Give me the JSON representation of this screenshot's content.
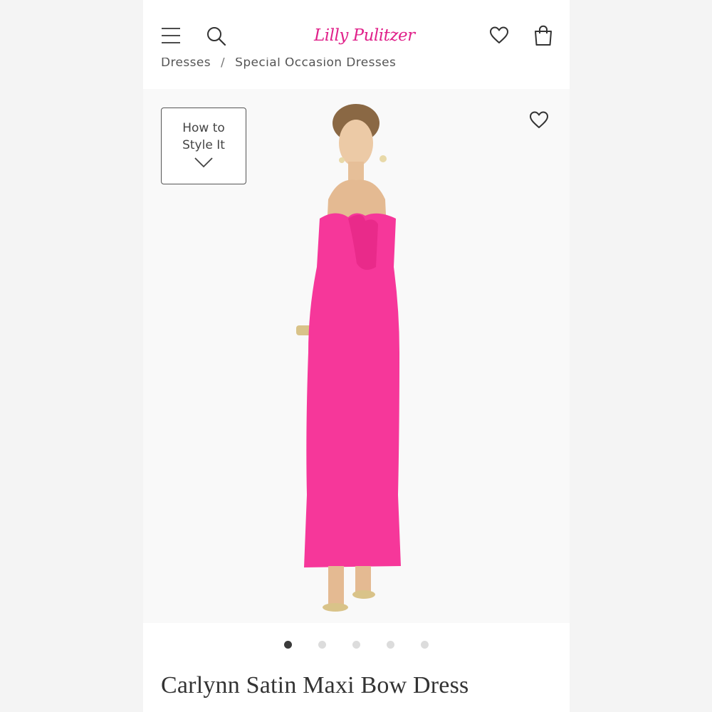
{
  "brand": {
    "logo_text": "Lilly Pulitzer",
    "accent_color": "#e0218a"
  },
  "header": {
    "icons": [
      "menu-icon",
      "search-icon",
      "heart-icon",
      "bag-icon"
    ]
  },
  "breadcrumb": {
    "items": [
      "Dresses",
      "Special Occasion Dresses"
    ],
    "separator": "/"
  },
  "gallery": {
    "style_button_label": "How to\nStyle It",
    "dress_color": "#f6379a",
    "image_count": 5,
    "active_index": 0
  },
  "product": {
    "title": "Carlynn Satin Maxi Bow Dress"
  }
}
